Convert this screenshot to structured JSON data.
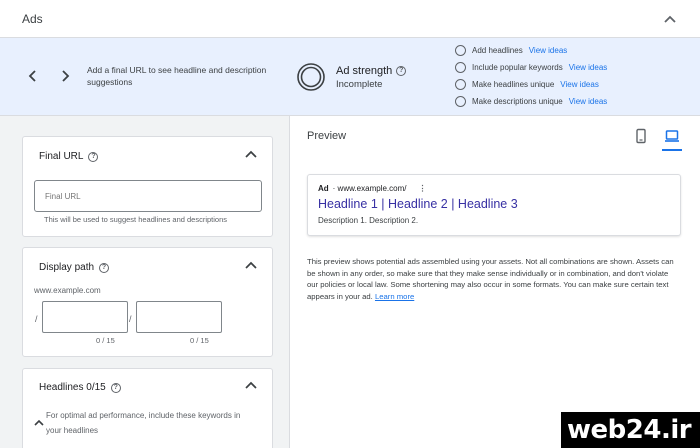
{
  "panel": {
    "title": "Ads"
  },
  "ad_strength": {
    "hint": "Add a final URL to see headline and description suggestions",
    "label": "Ad strength",
    "status": "Incomplete",
    "suggestions": [
      {
        "label": "Add headlines",
        "link": "View ideas"
      },
      {
        "label": "Include popular keywords",
        "link": "View ideas"
      },
      {
        "label": "Make headlines unique",
        "link": "View ideas"
      },
      {
        "label": "Make descriptions unique",
        "link": "View ideas"
      }
    ]
  },
  "final_url": {
    "title": "Final URL",
    "placeholder": "Final URL",
    "helper": "This will be used to suggest headlines and descriptions"
  },
  "display_path": {
    "title": "Display path",
    "example": "www.example.com",
    "separator": "/",
    "counters": [
      "0 / 15",
      "0 / 15"
    ]
  },
  "headlines": {
    "title": "Headlines 0/15",
    "hint": "For optimal ad performance, include these keywords in your headlines"
  },
  "preview": {
    "title": "Preview",
    "ad_badge": "Ad",
    "domain": "· www.example.com/",
    "menu": "⋮",
    "headline": "Headline 1 | Headline 2 | Headline 3",
    "description": "Description 1. Description 2.",
    "note": "This preview shows potential ads assembled using your assets. Not all combinations are shown. Assets can be shown in any order, so make sure that they make sense individually or in combination, and don't violate our policies or local law. Some shortening may also occur in some formats. You can make sure certain text appears in your ad.",
    "learn_more": "Learn more"
  },
  "watermark": "web24.ir",
  "colors": {
    "accent": "#1a73e8",
    "strength_bg": "#e8f0fe",
    "headline": "#3730a3",
    "left_bg": "#f1f3f4"
  },
  "icons": [
    "chevron-up-icon",
    "chevron-left-icon",
    "chevron-right-icon",
    "ring-icon",
    "help-icon",
    "mobile-icon",
    "desktop-icon"
  ]
}
